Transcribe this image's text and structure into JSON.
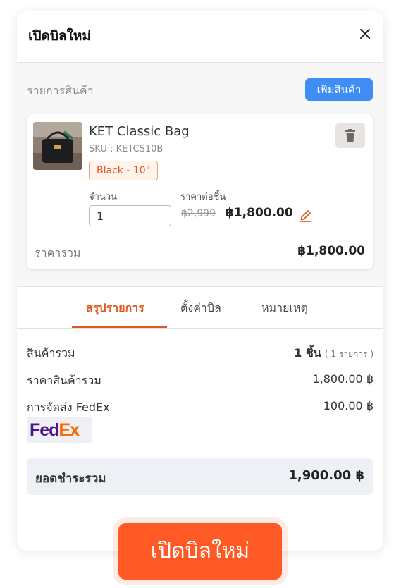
{
  "header": {
    "title": "เปิดบิลใหม่"
  },
  "items": {
    "label": "รายการสินค้า",
    "add_button": "เพิ่มสินค้า",
    "product": {
      "name": "KET Classic Bag",
      "sku": "SKU : KETCS10B",
      "variant": "Black - 10\"",
      "qty_label": "จำนวน",
      "qty_value": "1",
      "unit_price_label": "ราคาต่อชิ้น",
      "old_price": "฿2,999",
      "new_price": "฿1,800.00",
      "total_label": "ราคารวม",
      "total_value": "฿1,800.00"
    }
  },
  "tabs": [
    {
      "label": "สรุปรายการ",
      "active": true
    },
    {
      "label": "ตั้งค่าบิล",
      "active": false
    },
    {
      "label": "หมายเหตุ",
      "active": false
    }
  ],
  "summary": {
    "items_label": "สินค้ารวม",
    "items_count": "1 ชิ้น",
    "items_sub": "( 1 รายการ )",
    "subtotal_label": "ราคาสินค้ารวม",
    "subtotal_value": "1,800.00 ฿",
    "shipping_label": "การจัดส่ง FedEx",
    "shipping_value": "100.00 ฿",
    "carrier_logo": {
      "fed": "Fed",
      "ex": "Ex"
    },
    "grand_label": "ยอดชำระรวม",
    "grand_value": "1,900.00 ฿"
  },
  "submit_button": "เปิดบิลใหม่",
  "colors": {
    "accent": "#ff5a26",
    "primary": "#3f8ef5",
    "tab_active": "#e2571f"
  }
}
